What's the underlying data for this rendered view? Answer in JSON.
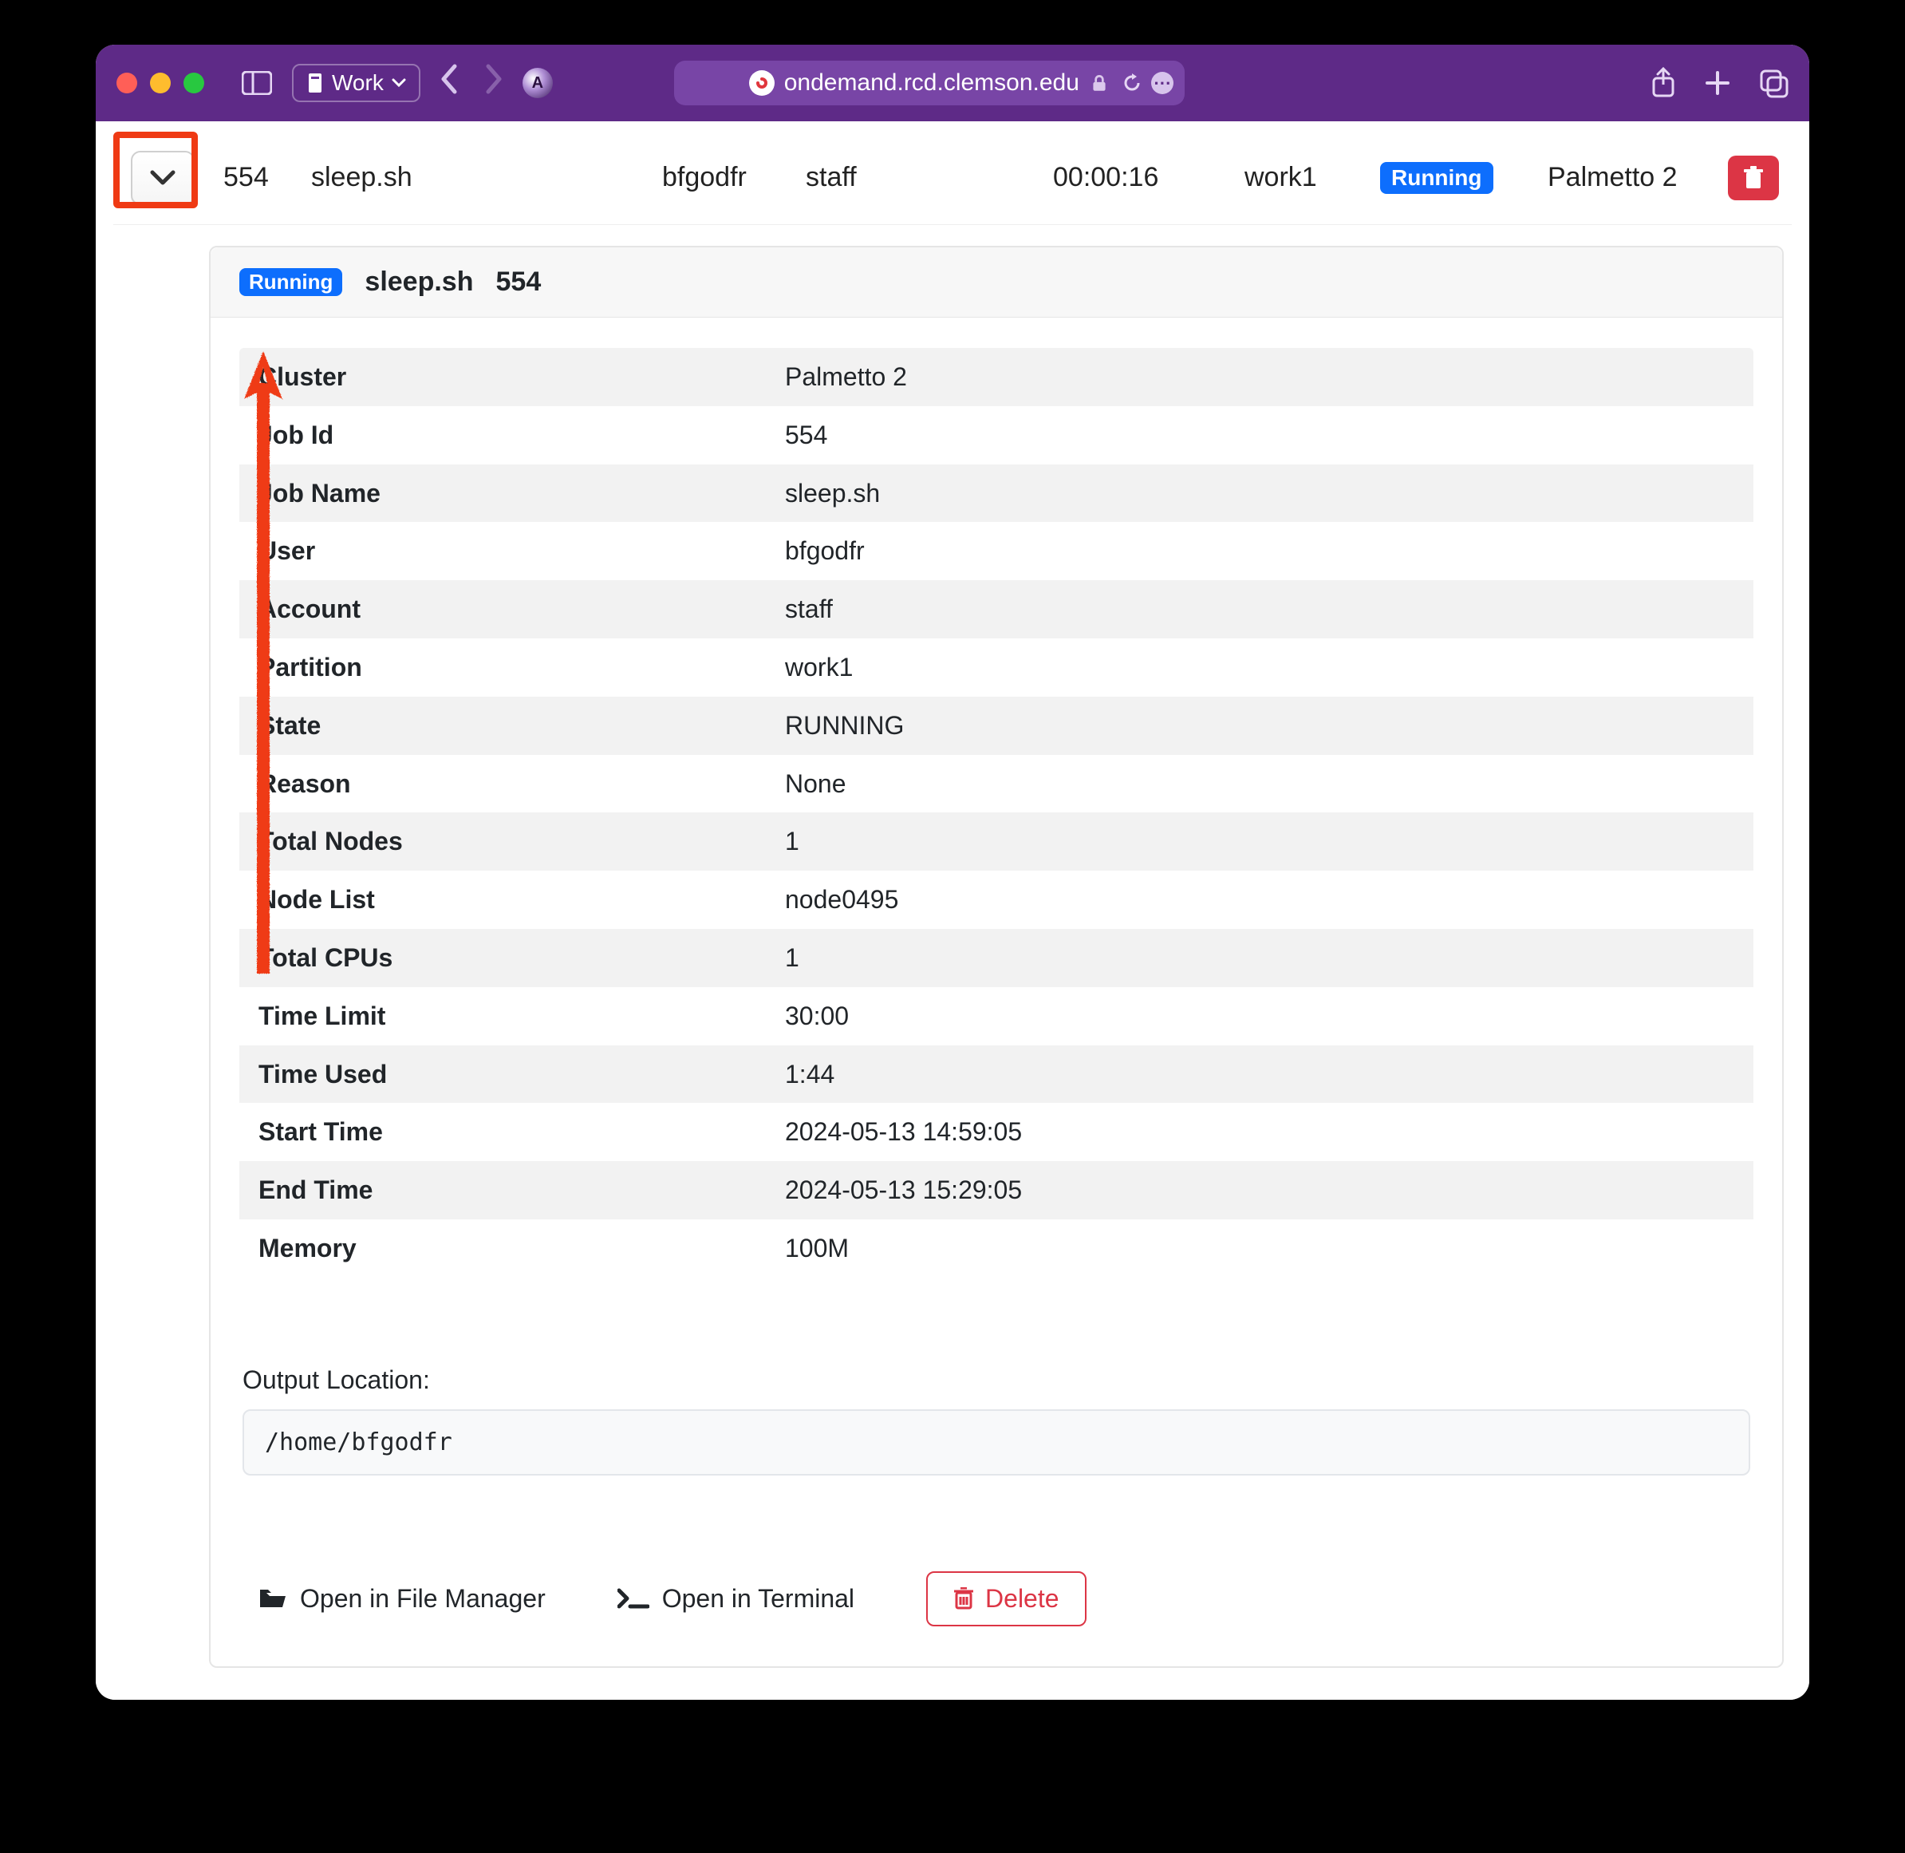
{
  "browser": {
    "profile_label": "Work",
    "address": "ondemand.rcd.clemson.edu"
  },
  "job_row": {
    "id": "554",
    "name": "sleep.sh",
    "user": "bfgodfr",
    "account": "staff",
    "time": "00:00:16",
    "partition": "work1",
    "status_label": "Running",
    "cluster": "Palmetto 2"
  },
  "panel": {
    "status_label": "Running",
    "name": "sleep.sh",
    "id": "554",
    "rows": [
      {
        "key": "Cluster",
        "val": "Palmetto 2"
      },
      {
        "key": "Job Id",
        "val": "554"
      },
      {
        "key": "Job Name",
        "val": "sleep.sh"
      },
      {
        "key": "User",
        "val": "bfgodfr"
      },
      {
        "key": "Account",
        "val": "staff"
      },
      {
        "key": "Partition",
        "val": "work1"
      },
      {
        "key": "State",
        "val": "RUNNING"
      },
      {
        "key": "Reason",
        "val": "None"
      },
      {
        "key": "Total Nodes",
        "val": "1"
      },
      {
        "key": "Node List",
        "val": "node0495"
      },
      {
        "key": "Total CPUs",
        "val": "1"
      },
      {
        "key": "Time Limit",
        "val": "30:00"
      },
      {
        "key": "Time Used",
        "val": "1:44"
      },
      {
        "key": "Start Time",
        "val": "2024-05-13 14:59:05"
      },
      {
        "key": "End Time",
        "val": "2024-05-13 15:29:05"
      },
      {
        "key": "Memory",
        "val": "100M"
      }
    ],
    "output_label": "Output Location:",
    "output_path": "/home/bfgodfr",
    "actions": {
      "open_fm": "Open in File Manager",
      "open_term": "Open in Terminal",
      "delete": "Delete"
    }
  }
}
